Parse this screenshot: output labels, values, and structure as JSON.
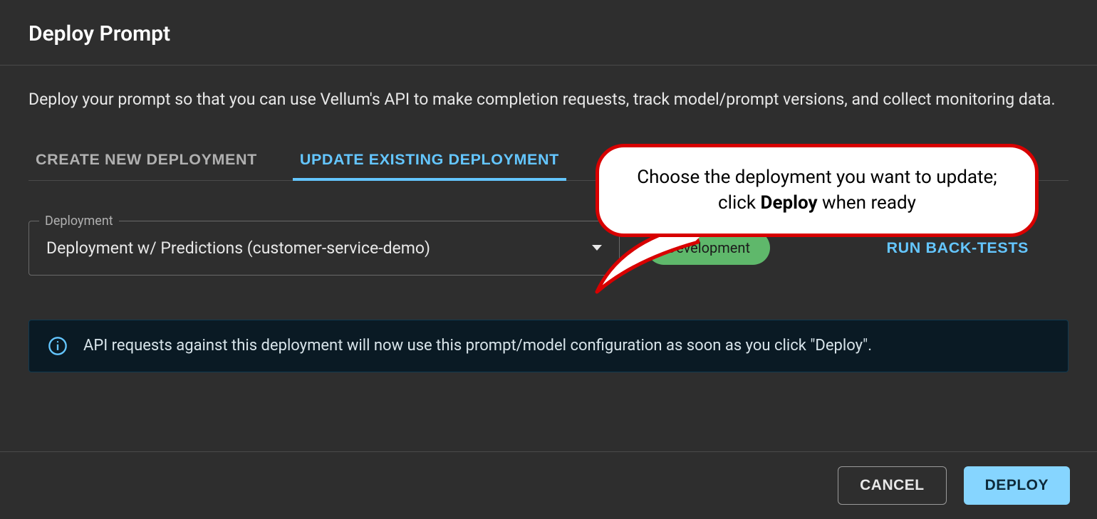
{
  "modal": {
    "title": "Deploy Prompt",
    "description": "Deploy your prompt so that you can use Vellum's API to make completion requests, track model/prompt versions, and collect monitoring data."
  },
  "tabs": {
    "create": "CREATE NEW DEPLOYMENT",
    "update": "UPDATE EXISTING DEPLOYMENT",
    "active": "update"
  },
  "form": {
    "select_label": "Deployment",
    "select_value": "Deployment w/ Predictions (customer-service-demo)",
    "chip_label": "Development",
    "run_back_tests": "RUN BACK-TESTS"
  },
  "info": {
    "text": "API requests against this deployment will now use this prompt/model configuration as soon as you click \"Deploy\"."
  },
  "footer": {
    "cancel": "CANCEL",
    "deploy": "DEPLOY"
  },
  "callout": {
    "part1": "Choose the deployment you want to update; click ",
    "bold": "Deploy",
    "part2": " when ready"
  }
}
